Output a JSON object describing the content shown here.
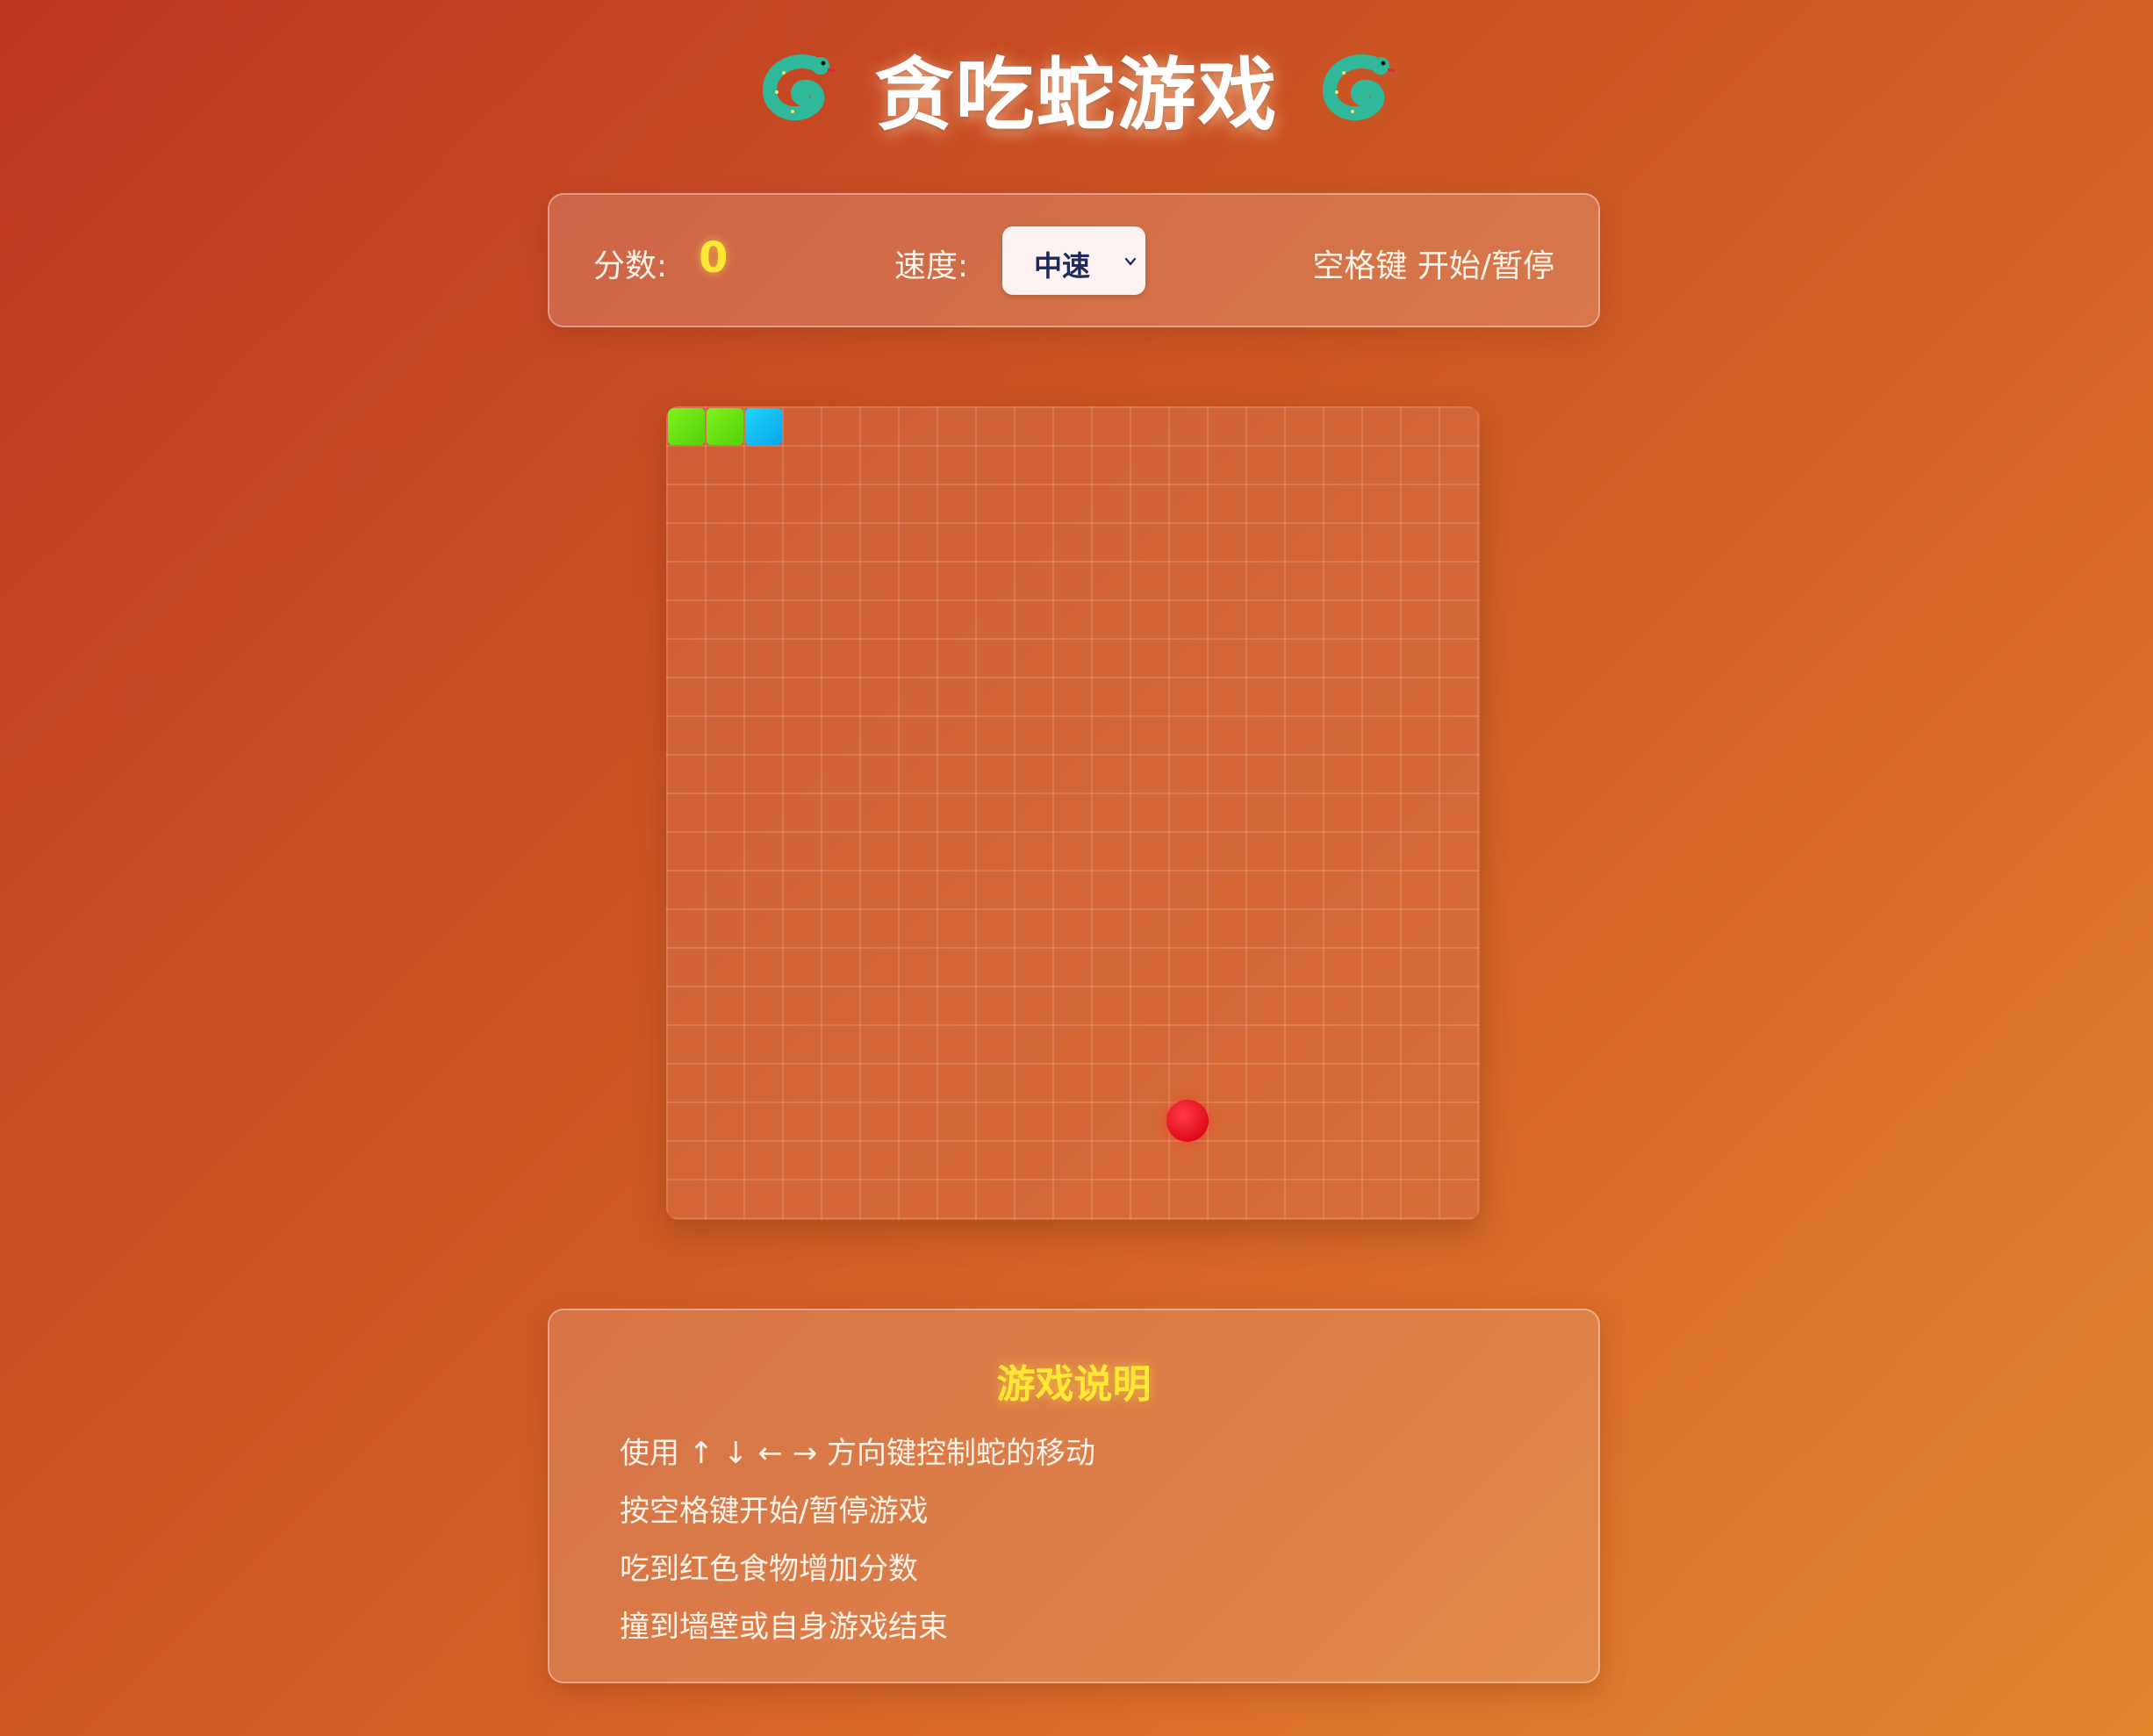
{
  "header": {
    "title": "贪吃蛇游戏",
    "left_icon": "snake-emoji-icon",
    "right_icon": "snake-emoji-icon"
  },
  "controls": {
    "score_label": "分数:",
    "score_value": "0",
    "speed_label": "速度:",
    "speed_selected": "中速",
    "hint": "空格键 开始/暂停"
  },
  "board": {
    "grid_cols": 21,
    "grid_rows": 21,
    "snake": [
      {
        "col": 0,
        "row": 0,
        "part": "body"
      },
      {
        "col": 1,
        "row": 0,
        "part": "body"
      },
      {
        "col": 2,
        "row": 0,
        "part": "head"
      }
    ],
    "food": {
      "col": 13,
      "row": 18
    },
    "colors": {
      "snake_body": "#6be814",
      "snake_head": "#12bff5",
      "food": "#e8101f"
    }
  },
  "instructions": {
    "title": "游戏说明",
    "items": [
      "使用 ↑ ↓ ← → 方向键控制蛇的移动",
      "按空格键开始/暂停游戏",
      "吃到红色食物增加分数",
      "撞到墙壁或自身游戏结束"
    ]
  },
  "colors": {
    "background_start": "#bf3621",
    "background_end": "#e3862c",
    "accent_yellow": "#ffe835"
  }
}
